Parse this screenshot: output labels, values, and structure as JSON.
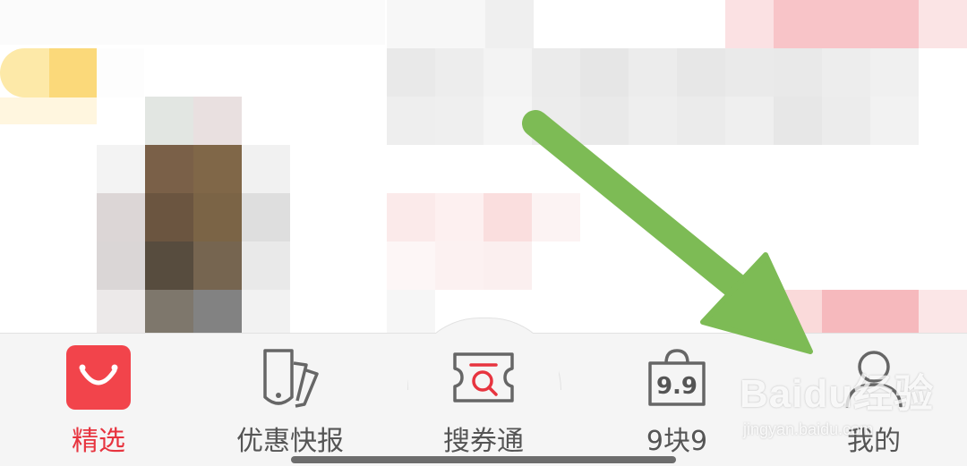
{
  "tabbar": {
    "tabs": [
      {
        "label": "精选",
        "icon": "bag-smile-icon",
        "active": true
      },
      {
        "label": "优惠快报",
        "icon": "tag-cards-icon",
        "active": false
      },
      {
        "label": "搜券通",
        "icon": "coupon-search-icon",
        "active": false
      },
      {
        "label": "9块9",
        "icon": "bag-9.9-icon",
        "icon_text": "9.9",
        "active": false
      },
      {
        "label": "我的",
        "icon": "person-icon",
        "active": false
      }
    ]
  },
  "watermark": {
    "logo_text": "Baidu经验",
    "url": "jingyan.baidu.com"
  },
  "colors": {
    "accent": "#e7343f",
    "inactive": "#555555",
    "arrow": "#7dbb55",
    "tabbar_bg": "#f5f5f5"
  }
}
